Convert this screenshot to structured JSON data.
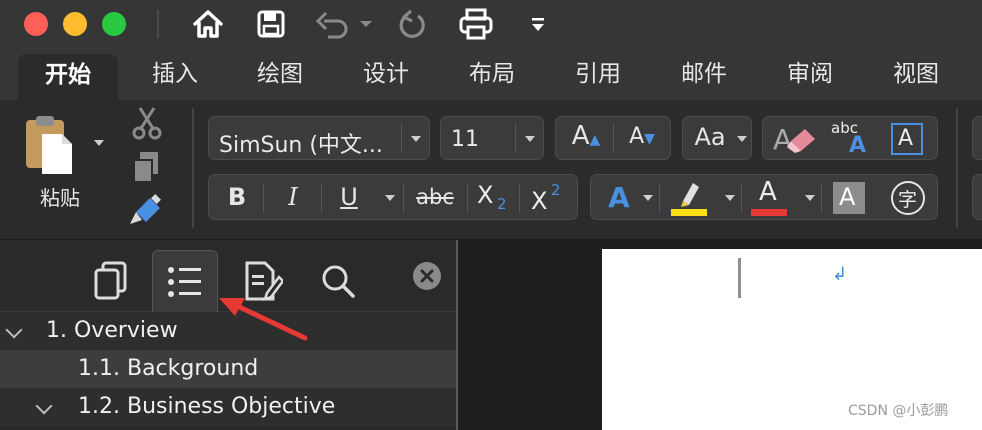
{
  "tabs": [
    "开始",
    "插入",
    "绘图",
    "设计",
    "布局",
    "引用",
    "邮件",
    "审阅",
    "视图"
  ],
  "active_tab": "开始",
  "clipboard": {
    "paste_label": "粘贴"
  },
  "font": {
    "name": "SimSun (中文...",
    "size": "11"
  },
  "format_buttons": {
    "bold": "B",
    "italic": "I",
    "underline": "U",
    "strike": "abc",
    "subscript": "X",
    "sub_digit": "2",
    "superscript": "X",
    "sup_digit": "2",
    "abc_small": "abc",
    "char_text": "字"
  },
  "nav_tree": [
    {
      "label": "1. Overview",
      "level": 1,
      "expanded": true
    },
    {
      "label": "1.1. Background",
      "level": 2,
      "expanded": false
    },
    {
      "label": "1.2. Business Objective",
      "level": 2,
      "expanded": true
    }
  ],
  "document": {
    "paragraph_mark": "↲"
  },
  "watermark": "CSDN @小彭鹏",
  "colors": {
    "highlight": "#ffe017",
    "font_color": "#e53935",
    "accent_blue": "#4a90e2",
    "annotation_arrow": "#e53935"
  }
}
